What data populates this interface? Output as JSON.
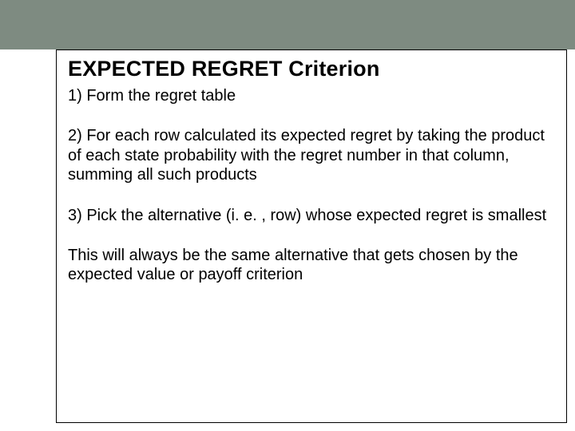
{
  "slide": {
    "title": "EXPECTED REGRET Criterion",
    "steps": [
      "1)  Form the regret table",
      "2)  For each row calculated its expected regret by taking the product of each state probability with the regret number in that column, summing all such products",
      "3) Pick the alternative (i. e. , row) whose expected regret is smallest"
    ],
    "note": "This will always be the same alternative that gets chosen by the expected value or payoff criterion"
  }
}
